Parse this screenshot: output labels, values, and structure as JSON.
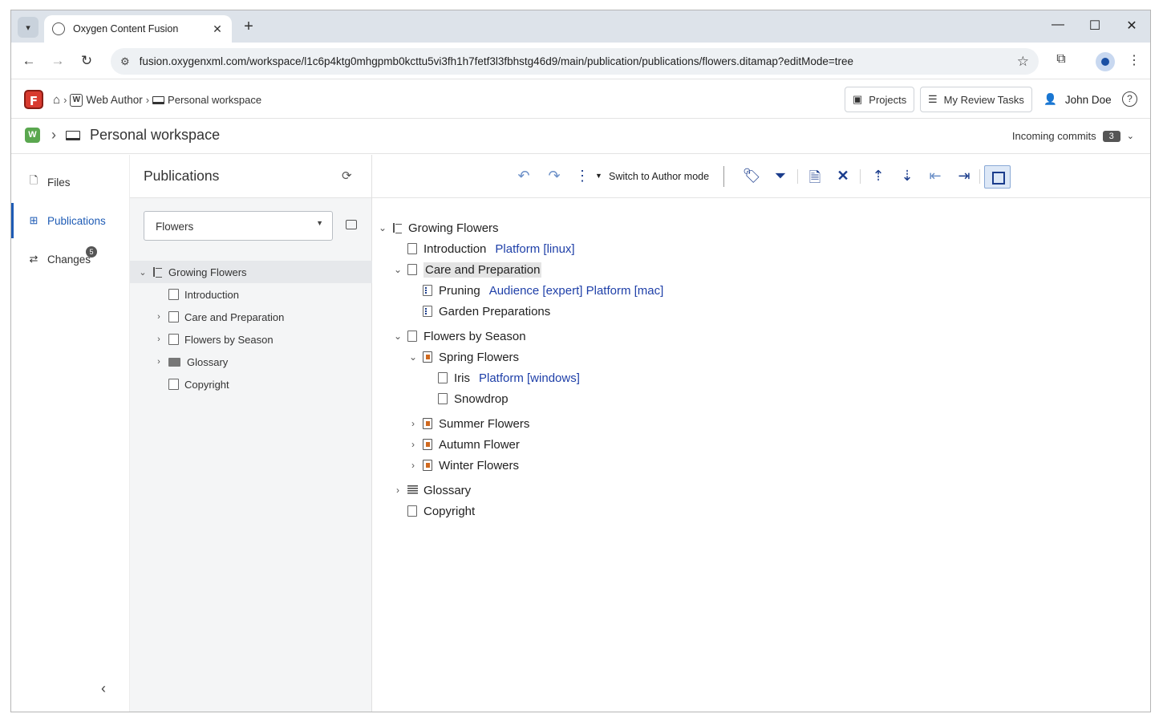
{
  "browser": {
    "tab_title": "Oxygen Content Fusion",
    "url": "fusion.oxygenxml.com/workspace/l1c6p4ktg0mhgpmb0kcttu5vi3fh1h7fetf3l3fbhstg46d9/main/publication/publications/flowers.ditamap?editMode=tree"
  },
  "header": {
    "breadcrumb_web_author": "Web Author",
    "breadcrumb_workspace": "Personal workspace",
    "projects_label": "Projects",
    "review_tasks_label": "My Review Tasks",
    "user_name": "John Doe"
  },
  "workspace_bar": {
    "title": "Personal workspace",
    "incoming_label": "Incoming commits",
    "incoming_count": "3"
  },
  "sidebar": {
    "items": [
      {
        "label": "Files"
      },
      {
        "label": "Publications"
      },
      {
        "label": "Changes"
      }
    ],
    "changes_badge": "5"
  },
  "publications": {
    "title": "Publications",
    "selected": "Flowers",
    "tree": [
      {
        "label": "Growing Flowers"
      },
      {
        "label": "Introduction"
      },
      {
        "label": "Care and Preparation"
      },
      {
        "label": "Flowers by Season"
      },
      {
        "label": "Glossary"
      },
      {
        "label": "Copyright"
      }
    ]
  },
  "toolbar": {
    "switch_label": "Switch to Author mode"
  },
  "editor_tree": [
    {
      "label": "Growing Flowers"
    },
    {
      "label": "Introduction",
      "profile": "Platform [linux]"
    },
    {
      "label": "Care and Preparation"
    },
    {
      "label": "Pruning",
      "profile": "Audience [expert] Platform [mac]"
    },
    {
      "label": "Garden Preparations"
    },
    {
      "label": "Flowers by Season"
    },
    {
      "label": "Spring Flowers"
    },
    {
      "label": "Iris",
      "profile": "Platform [windows]"
    },
    {
      "label": "Snowdrop"
    },
    {
      "label": "Summer Flowers"
    },
    {
      "label": "Autumn Flower"
    },
    {
      "label": "Winter Flowers"
    },
    {
      "label": "Glossary"
    },
    {
      "label": "Copyright"
    }
  ]
}
